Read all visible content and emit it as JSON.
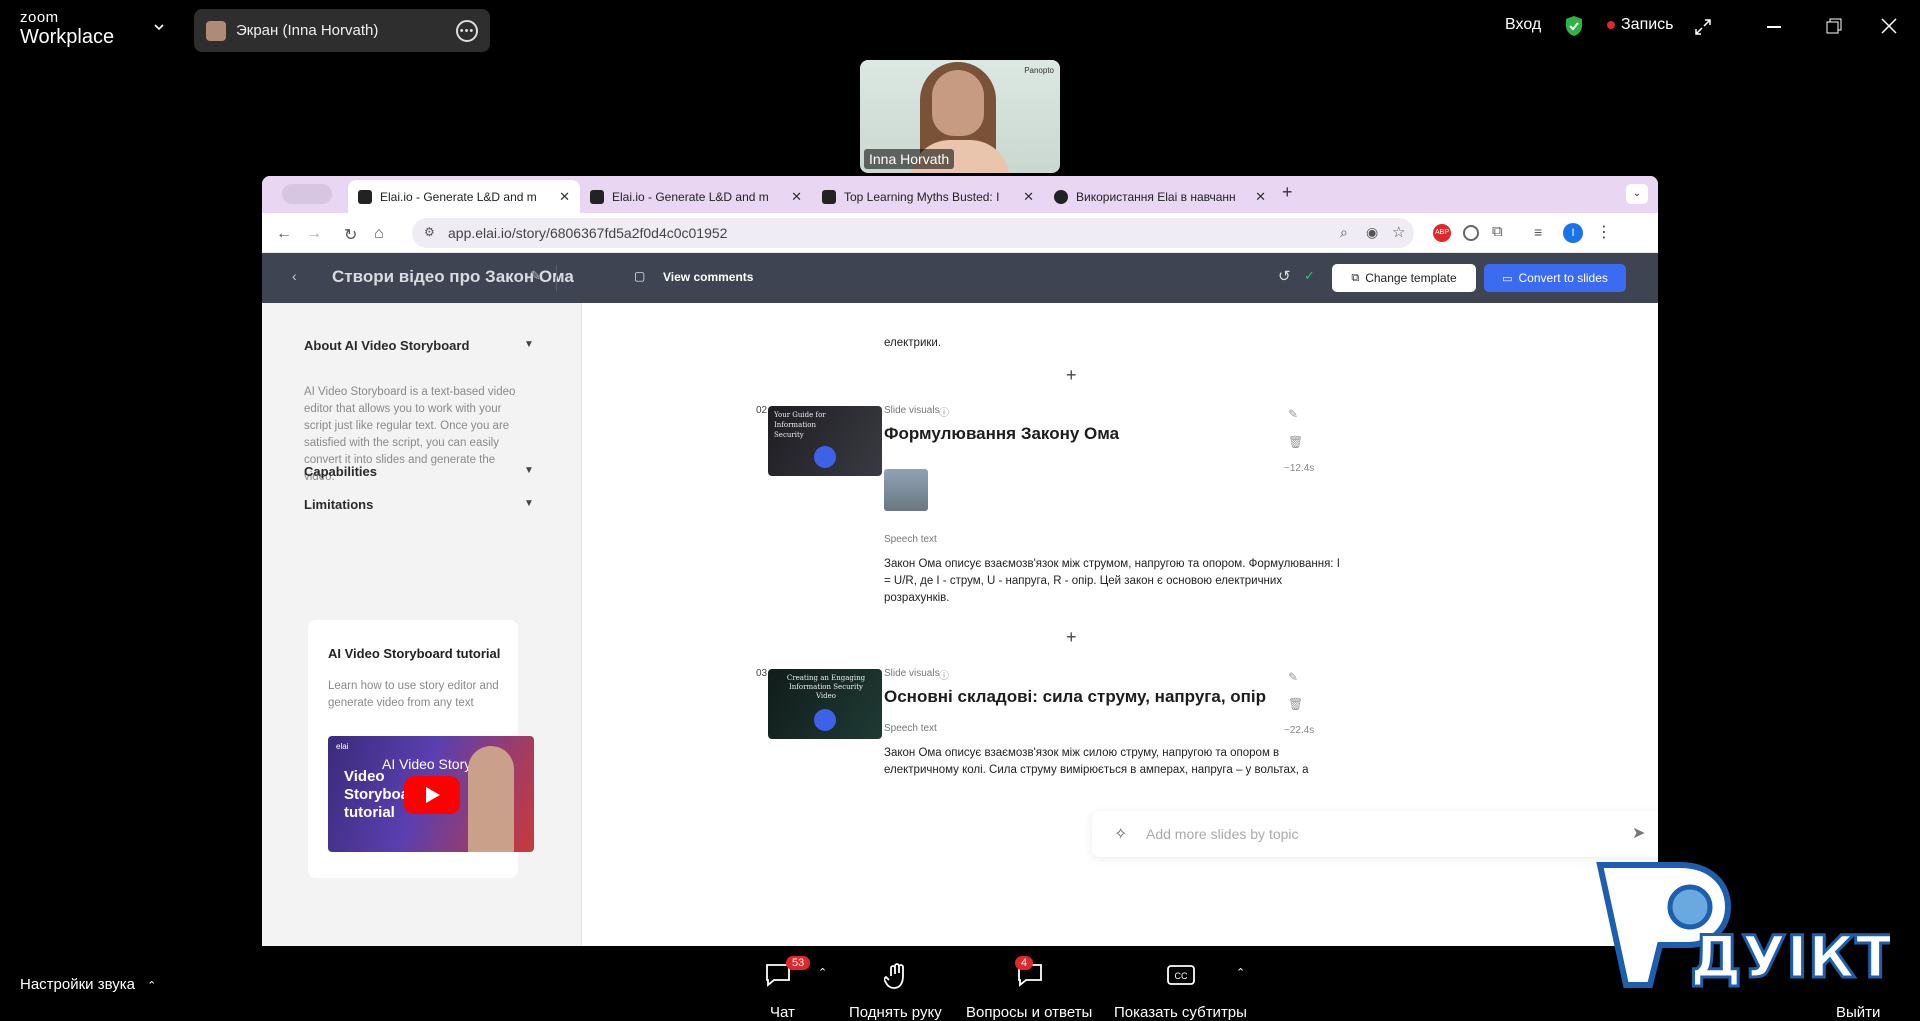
{
  "zoom": {
    "logo_line1": "zoom",
    "logo_line2": "Workplace",
    "share_label": "Экран (Inna Horvath)",
    "signin": "Вход",
    "recording": "Запись",
    "participant_name": "Inna Horvath",
    "cam_brand": "Panopto",
    "audio_settings": "Настройки звука",
    "chat_label": "Чат",
    "chat_badge": "53",
    "raise_hand": "Поднять руку",
    "qa_label": "Вопросы и ответы",
    "qa_badge": "4",
    "captions": "Показать субтитры",
    "leave": "Выйти",
    "watermark": "ДУІКТ"
  },
  "browser": {
    "tabs": [
      {
        "title": "Elai.io - Generate L&D and m",
        "active": true
      },
      {
        "title": "Elai.io - Generate L&D and m",
        "active": false
      },
      {
        "title": "Top Learning Myths Busted: I",
        "active": false
      },
      {
        "title": "Використання Elai в навчанн",
        "active": false
      }
    ],
    "url": "app.elai.io/story/6806367fd5a2f0d4c0c01952",
    "profile_initial": "I",
    "ext_badge": "ABP"
  },
  "elai": {
    "story_title": "Створи відео про Закон Ома",
    "view_comments": "View comments",
    "change_template": "Change template",
    "convert_to_slides": "Convert to slides"
  },
  "sidebar": {
    "about_title": "About AI Video Storyboard",
    "about_text": "AI Video Storyboard is a text-based video editor that allows you to work with your script just like regular text. Once you are satisfied with the script, you can easily convert it into slides and generate the video.",
    "capabilities": "Capabilities",
    "limitations": "Limitations",
    "tutorial_title": "AI Video Storyboard tutorial",
    "tutorial_text": "Learn how to use story editor and generate video from any text",
    "video_title": "AI Video Storyboar...",
    "video_brand": "elai",
    "video_overlay": "Video Storyboard tutorial"
  },
  "main": {
    "prev_text_tail": "електрики.",
    "slides": [
      {
        "num": "02",
        "visuals_label": "Slide visuals",
        "title": "Формулювання Закону Ома",
        "speech_label": "Speech text",
        "speech": "Закон Ома описує взаємозв'язок між струмом, напругою та опором. Формулювання: I = U/R, де I - струм, U - напруга, R - опір. Цей закон є основою електричних розрахунків.",
        "duration": "~12.4s",
        "thumb_text": "Your Guide for Information Security"
      },
      {
        "num": "03",
        "visuals_label": "Slide visuals",
        "title": "Основні складові: сила струму, напруга, опір",
        "speech_label": "Speech text",
        "speech": "Закон Ома описує взаємозв'язок між силою струму, напругою та опором в електричному колі. Сила струму вимірюється в амперах, напруга – у вольтах, а",
        "duration": "~22.4s",
        "thumb_text": "Creating an Engaging Information Security Video"
      }
    ],
    "prompt_placeholder": "Add more slides by topic"
  }
}
